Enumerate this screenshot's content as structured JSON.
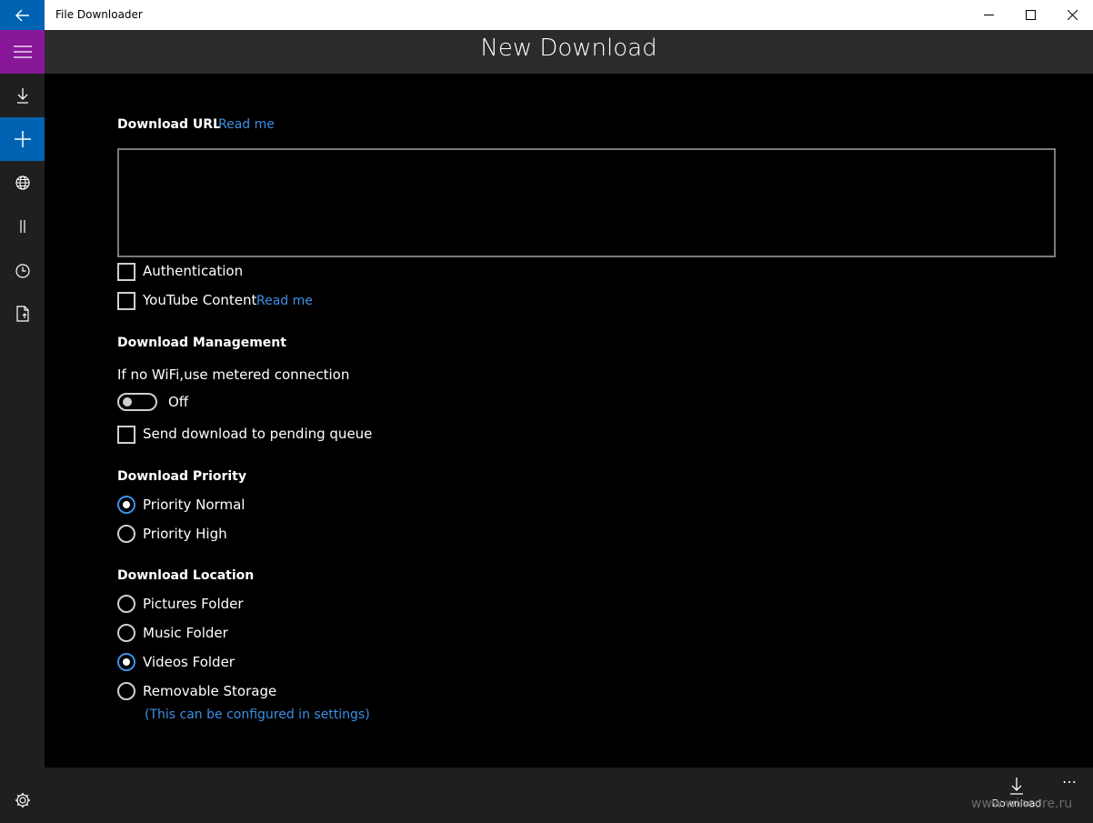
{
  "window": {
    "title": "File Downloader",
    "back_icon": "arrow-left-icon",
    "minimize_icon": "minimize-icon",
    "maximize_icon": "maximize-icon",
    "close_icon": "close-icon"
  },
  "nav": {
    "items": [
      {
        "name": "hamburger-menu",
        "icon": "hamburger-icon"
      },
      {
        "name": "downloads",
        "icon": "download-icon"
      },
      {
        "name": "new-download",
        "icon": "plus-icon",
        "selected": true
      },
      {
        "name": "browser",
        "icon": "globe-icon"
      },
      {
        "name": "paused",
        "icon": "pause-icon"
      },
      {
        "name": "history",
        "icon": "clock-icon"
      },
      {
        "name": "files",
        "icon": "file-icon"
      },
      {
        "name": "settings",
        "icon": "gear-icon"
      }
    ]
  },
  "header": {
    "title": "New Download"
  },
  "form": {
    "url_label": "Download URL",
    "url_readme": "Read me",
    "url_value": "",
    "authentication_label": "Authentication",
    "youtube_label": "YouTube Content",
    "youtube_readme": "Read me",
    "management_heading": "Download Management",
    "metered_label": "If no WiFi,use metered connection",
    "metered_state": "Off",
    "pending_label": "Send download to pending queue",
    "priority_heading": "Download Priority",
    "priority_options": [
      "Priority Normal",
      "Priority High"
    ],
    "priority_selected": "Priority Normal",
    "location_heading": "Download Location",
    "location_options": [
      "Pictures Folder",
      "Music Folder",
      "Videos Folder",
      "Removable Storage"
    ],
    "location_selected": "Videos Folder",
    "location_note": "(This can be configured in settings)"
  },
  "commandbar": {
    "download_label": "Download",
    "more_label": "…"
  },
  "watermark": "www.wincore.ru",
  "colors": {
    "accent": "#0063b1",
    "hamburger": "#881798",
    "link": "#3c8fe6"
  }
}
